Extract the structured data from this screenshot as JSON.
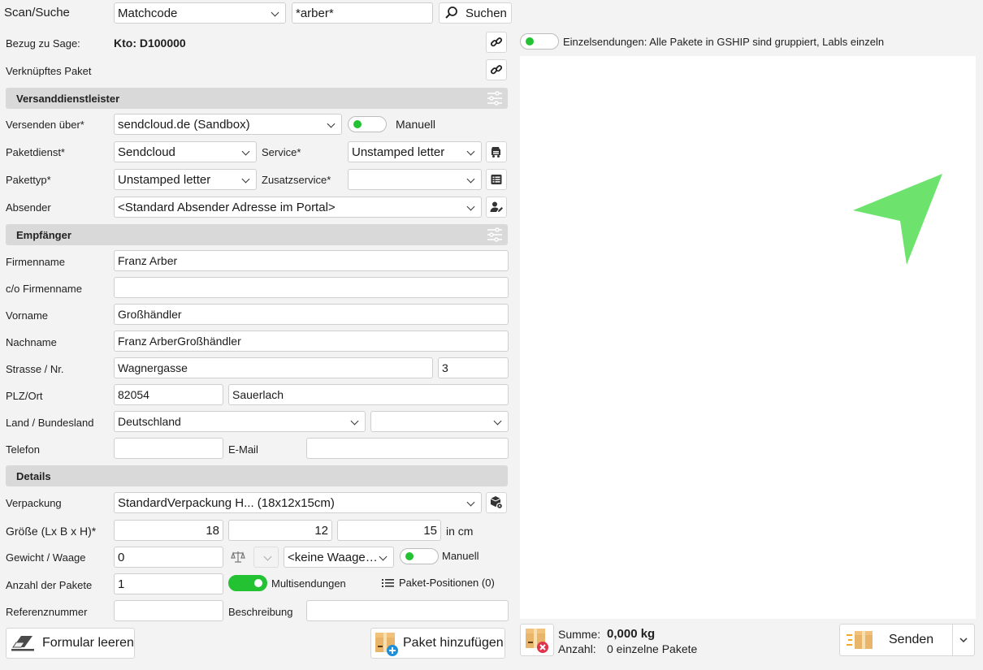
{
  "scan": {
    "label": "Scan/Suche",
    "mode": "Matchcode",
    "query": "*arber*",
    "search_button": "Suchen"
  },
  "sage": {
    "label": "Bezug zu Sage:",
    "value": "Kto: D100000"
  },
  "linked_package": {
    "label": "Verknüpftes Paket"
  },
  "single_shipments": {
    "text": "Einzelsendungen: Alle Pakete in GSHIP sind gruppiert, Labls einzeln"
  },
  "carrier": {
    "section_title": "Versanddienstleister",
    "send_via_label": "Versenden über*",
    "send_via_value": "sendcloud.de (Sandbox)",
    "manual_label": "Manuell",
    "service_provider_label": "Paketdienst*",
    "service_provider_value": "Sendcloud",
    "service_label": "Service*",
    "service_value": "Unstamped letter",
    "package_type_label": "Pakettyp*",
    "package_type_value": "Unstamped letter",
    "extra_service_label": "Zusatzservice*",
    "extra_service_value": "",
    "sender_label": "Absender",
    "sender_value": "<Standard Absender Adresse im Portal>"
  },
  "recipient": {
    "section_title": "Empfänger",
    "company_label": "Firmenname",
    "company_value": "Franz Arber",
    "co_label": "c/o Firmenname",
    "co_value": "",
    "firstname_label": "Vorname",
    "firstname_value": "Großhändler",
    "lastname_label": "Nachname",
    "lastname_value": "Franz ArberGroßhändler",
    "street_label": "Strasse / Nr.",
    "street_value": "Wagnergasse",
    "house_no": "3",
    "zip_city_label": "PLZ/Ort",
    "zip": "82054",
    "city": "Sauerlach",
    "country_label": "Land / Bundesland",
    "country": "Deutschland",
    "state": "",
    "phone_label": "Telefon",
    "phone": "",
    "email_label": "E-Mail",
    "email": ""
  },
  "details": {
    "section_title": "Details",
    "packaging_label": "Verpackung",
    "packaging_value": "StandardVerpackung H... (18x12x15cm)",
    "size_label": "Größe (Lx B x H)*",
    "length": "18",
    "width": "12",
    "height": "15",
    "unit": "in cm",
    "weight_label": "Gewicht / Waage",
    "weight": "0",
    "scale_value": "<keine Waage…",
    "manual_label": "Manuell",
    "count_label": "Anzahl der Pakete",
    "count": "1",
    "multi_label": "Multisendungen",
    "positions_label": "Paket-Positionen (0)",
    "reference_label": "Referenznummer",
    "reference": "",
    "description_label": "Beschreibung",
    "description": ""
  },
  "footer": {
    "clear_button": "Formular leeren",
    "add_package_button": "Paket hinzufügen",
    "sum_label": "Summe:",
    "sum_value": "0,000 kg",
    "count_label": "Anzahl:",
    "count_value": "0 einzelne Pakete",
    "send_button": "Senden"
  },
  "colors": {
    "toggle_green": "#22c232",
    "cursor_green": "#6de36d",
    "section_bg": "#d9d9d9"
  }
}
